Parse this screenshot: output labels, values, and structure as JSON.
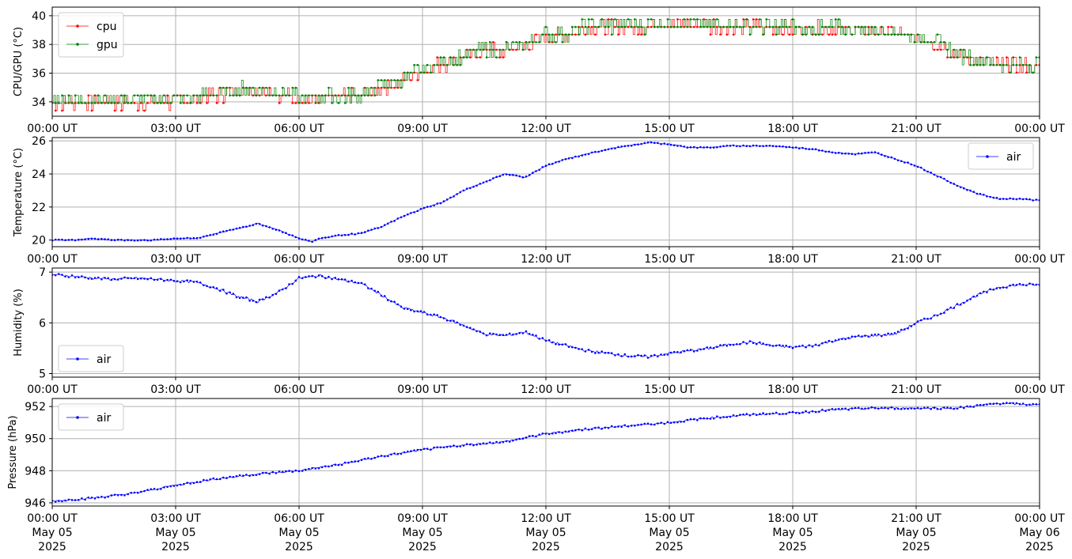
{
  "chart_data": [
    {
      "type": "line",
      "ylabel": "CPU/GPU (°C)",
      "ylim": [
        33.0,
        40.6
      ],
      "yticks": [
        34,
        36,
        38,
        40
      ],
      "xlim": [
        0,
        24
      ],
      "xticks": [
        "00:00 UT",
        "03:00 UT",
        "06:00 UT",
        "09:00 UT",
        "12:00 UT",
        "15:00 UT",
        "18:00 UT",
        "21:00 UT",
        "00:00 UT"
      ],
      "grid": true,
      "legend": "upper-left",
      "series": [
        {
          "name": "cpu",
          "color": "#ff0000",
          "x_hours": [
            0,
            1,
            2,
            3,
            4,
            4.5,
            5,
            6,
            7,
            7.5,
            8,
            8.5,
            9,
            9.5,
            10,
            10.5,
            11,
            11.5,
            12,
            12.5,
            13,
            14,
            15,
            16,
            17,
            18,
            19,
            20,
            21,
            21.5,
            22,
            22.5,
            23,
            24
          ],
          "values": [
            33.9,
            34.0,
            33.9,
            34.0,
            34.5,
            34.8,
            34.8,
            34.2,
            34.3,
            34.4,
            35.0,
            35.5,
            36.2,
            36.6,
            37.1,
            37.6,
            37.5,
            37.9,
            38.6,
            38.6,
            39.2,
            39.2,
            39.4,
            39.3,
            39.2,
            39.1,
            39.0,
            39.0,
            38.5,
            38.0,
            37.3,
            36.8,
            36.5,
            36.5
          ]
        },
        {
          "name": "gpu",
          "color": "#008000",
          "x_hours": [
            0,
            1,
            2,
            3,
            4,
            4.5,
            5,
            6,
            7,
            7.5,
            8,
            8.5,
            9,
            9.5,
            10,
            10.5,
            11,
            11.5,
            12,
            12.5,
            13,
            14,
            15,
            16,
            17,
            18,
            19,
            20,
            21,
            21.5,
            22,
            22.5,
            23,
            24
          ],
          "values": [
            34.1,
            34.2,
            34.1,
            34.2,
            34.6,
            34.9,
            34.9,
            34.3,
            34.4,
            34.5,
            35.1,
            35.6,
            36.3,
            36.7,
            37.2,
            37.7,
            37.6,
            38.0,
            38.7,
            38.7,
            39.3,
            39.3,
            39.5,
            39.4,
            39.3,
            39.2,
            39.1,
            39.1,
            38.6,
            38.1,
            37.4,
            36.9,
            36.6,
            36.6
          ]
        }
      ]
    },
    {
      "type": "line",
      "ylabel": "Temperature (°C)",
      "ylim": [
        19.6,
        26.2
      ],
      "yticks": [
        20,
        22,
        24,
        26
      ],
      "xlim": [
        0,
        24
      ],
      "xticks": [
        "00:00 UT",
        "03:00 UT",
        "06:00 UT",
        "09:00 UT",
        "12:00 UT",
        "15:00 UT",
        "18:00 UT",
        "21:00 UT",
        "00:00 UT"
      ],
      "grid": true,
      "legend": "upper-right",
      "series": [
        {
          "name": "air",
          "color": "#0000ff",
          "x_hours": [
            0,
            0.5,
            1,
            1.5,
            2,
            2.5,
            3,
            3.5,
            4,
            4.5,
            5,
            5.5,
            6,
            6.3,
            6.5,
            7,
            7.5,
            8,
            8.5,
            9,
            9.5,
            10,
            10.5,
            11,
            11.5,
            12,
            12.5,
            13,
            13.5,
            14,
            14.5,
            15,
            15.5,
            16,
            16.5,
            17,
            17.5,
            18,
            18.5,
            19,
            19.5,
            20,
            20.5,
            21,
            21.5,
            22,
            22.5,
            23,
            23.5,
            24
          ],
          "values": [
            20.0,
            20.0,
            20.1,
            20.0,
            20.0,
            20.0,
            20.1,
            20.1,
            20.4,
            20.7,
            21.0,
            20.6,
            20.1,
            19.9,
            20.1,
            20.3,
            20.4,
            20.8,
            21.4,
            21.9,
            22.3,
            23.0,
            23.5,
            24.0,
            23.8,
            24.5,
            24.9,
            25.2,
            25.5,
            25.7,
            25.9,
            25.8,
            25.6,
            25.6,
            25.7,
            25.7,
            25.7,
            25.6,
            25.5,
            25.3,
            25.2,
            25.3,
            24.9,
            24.5,
            23.9,
            23.3,
            22.8,
            22.5,
            22.5,
            22.4
          ]
        }
      ]
    },
    {
      "type": "line",
      "ylabel": "Humidity (%)",
      "ylim": [
        4.93,
        7.08
      ],
      "yticks": [
        5,
        6,
        7
      ],
      "xlim": [
        0,
        24
      ],
      "xticks": [
        "00:00 UT",
        "03:00 UT",
        "06:00 UT",
        "09:00 UT",
        "12:00 UT",
        "15:00 UT",
        "18:00 UT",
        "21:00 UT",
        "00:00 UT"
      ],
      "grid": true,
      "legend": "lower-left",
      "series": [
        {
          "name": "air",
          "color": "#0000ff",
          "x_hours": [
            0,
            0.5,
            1,
            1.5,
            2,
            2.5,
            3,
            3.5,
            4,
            4.5,
            5,
            5.5,
            6,
            6.5,
            7,
            7.5,
            8,
            8.5,
            9,
            9.5,
            10,
            10.5,
            11,
            11.5,
            12,
            12.5,
            13,
            13.5,
            14,
            14.5,
            15,
            15.5,
            16,
            16.5,
            17,
            17.5,
            18,
            18.5,
            19,
            19.5,
            20,
            20.5,
            21,
            21.5,
            22,
            22.5,
            23,
            23.5,
            24
          ],
          "values": [
            6.95,
            6.92,
            6.88,
            6.86,
            6.88,
            6.86,
            6.83,
            6.8,
            6.68,
            6.52,
            6.42,
            6.6,
            6.88,
            6.93,
            6.85,
            6.78,
            6.55,
            6.3,
            6.2,
            6.1,
            5.95,
            5.78,
            5.75,
            5.82,
            5.65,
            5.55,
            5.45,
            5.4,
            5.35,
            5.33,
            5.4,
            5.45,
            5.5,
            5.58,
            5.62,
            5.55,
            5.52,
            5.55,
            5.65,
            5.72,
            5.75,
            5.78,
            6.0,
            6.15,
            6.35,
            6.55,
            6.7,
            6.75,
            6.75
          ]
        }
      ]
    },
    {
      "type": "line",
      "ylabel": "Pressure (hPa)",
      "ylim": [
        945.8,
        952.5
      ],
      "yticks": [
        946,
        948,
        950,
        952
      ],
      "xlim": [
        0,
        24
      ],
      "xticks": [
        "00:00 UT",
        "03:00 UT",
        "06:00 UT",
        "09:00 UT",
        "12:00 UT",
        "15:00 UT",
        "18:00 UT",
        "21:00 UT",
        "00:00 UT"
      ],
      "xticks_sub": [
        "May 05",
        "May 05",
        "May 05",
        "May 05",
        "May 05",
        "May 05",
        "May 05",
        "May 05",
        "May 06"
      ],
      "xticks_year": "2025",
      "grid": true,
      "legend": "upper-left",
      "series": [
        {
          "name": "air",
          "color": "#0000ff",
          "x_hours": [
            0,
            1,
            2,
            3,
            4,
            5,
            6,
            7,
            8,
            9,
            10,
            11,
            12,
            13,
            14,
            15,
            16,
            17,
            18,
            19,
            20,
            21,
            22,
            23,
            24
          ],
          "values": [
            946.1,
            946.3,
            946.6,
            947.1,
            947.5,
            947.8,
            948.0,
            948.4,
            948.9,
            949.3,
            949.6,
            949.8,
            950.3,
            950.6,
            950.8,
            951.0,
            951.3,
            951.5,
            951.6,
            951.8,
            951.9,
            951.9,
            951.9,
            952.2,
            952.1
          ]
        }
      ]
    }
  ]
}
